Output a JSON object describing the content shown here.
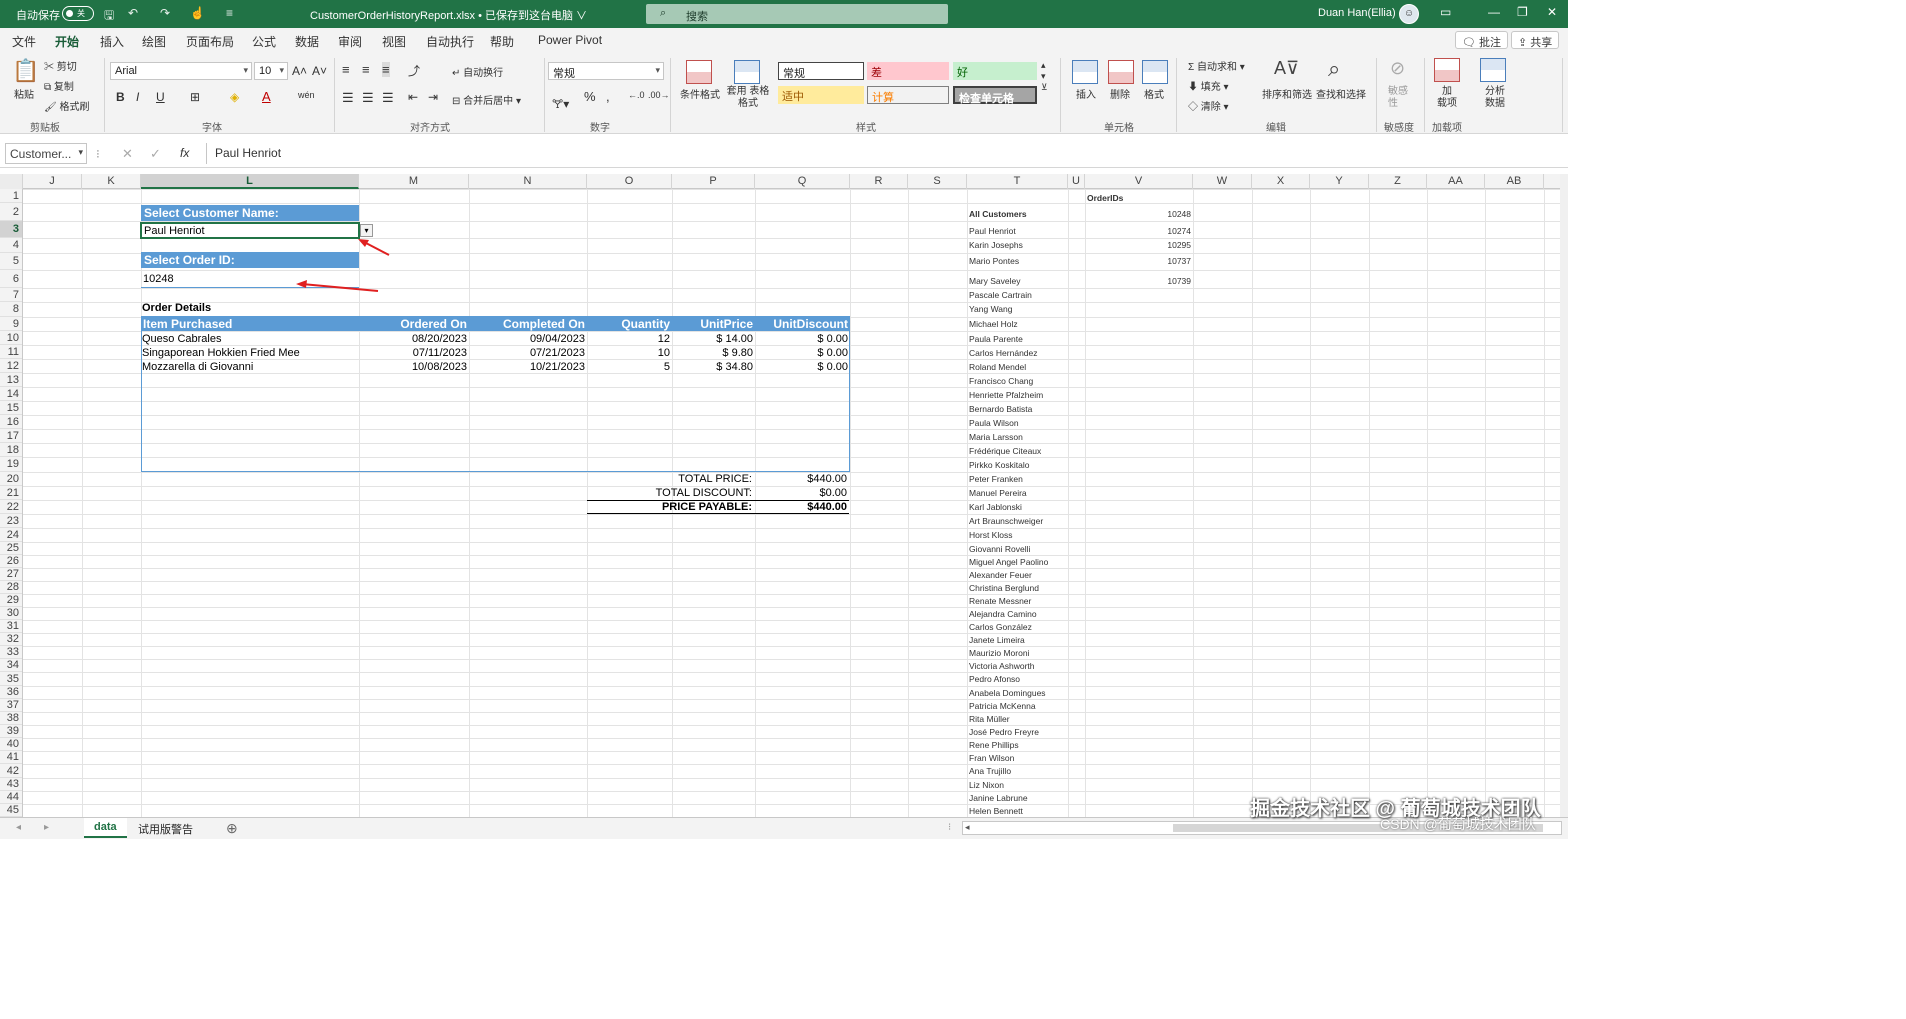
{
  "titlebar": {
    "autosave_label": "自动保存",
    "autosave_state": "关",
    "filename": "CustomerOrderHistoryReport.xlsx • 已保存到这台电脑 ∨",
    "search_placeholder": "搜索",
    "user": "Duan Han(Ellia)"
  },
  "menus": [
    "文件",
    "开始",
    "插入",
    "绘图",
    "页面布局",
    "公式",
    "数据",
    "审阅",
    "视图",
    "自动执行",
    "帮助",
    "Power Pivot"
  ],
  "menu_right": {
    "comment": "批注",
    "share": "共享"
  },
  "ribbon": {
    "clipboard": {
      "paste": "粘贴",
      "cut": "剪切",
      "copy": "复制",
      "format_painter": "格式刷",
      "label": "剪贴板"
    },
    "font": {
      "name": "Arial",
      "size": "10",
      "label": "字体",
      "bold": "B",
      "italic": "I",
      "underline": "U"
    },
    "alignment": {
      "wrap": "自动换行",
      "merge": "合并后居中",
      "label": "对齐方式"
    },
    "number": {
      "format": "常规",
      "label": "数字"
    },
    "styles": {
      "conditional": "条件格式",
      "table": "套用 表格格式",
      "normal": "常规",
      "bad": "差",
      "good": "好",
      "neutral": "适中",
      "calc": "计算",
      "check": "检查单元格",
      "label": "样式"
    },
    "cells": {
      "insert": "插入",
      "delete": "删除",
      "format": "格式",
      "label": "单元格"
    },
    "editing": {
      "autosum": "自动求和",
      "fill": "填充",
      "clear": "清除",
      "sort": "排序和筛选",
      "find": "查找和选择",
      "label": "编辑"
    },
    "sensitivity": {
      "btn": "敏感 性",
      "label": "敏感度"
    },
    "addins": {
      "btn": "加 载项",
      "label": "加载项"
    },
    "analyze": {
      "btn": "分析 数据"
    }
  },
  "formula": {
    "namebox": "Customer...",
    "fx": "fx",
    "value": "Paul Henriot"
  },
  "columns": [
    "J",
    "K",
    "L",
    "M",
    "N",
    "O",
    "P",
    "Q",
    "R",
    "S",
    "T",
    "U",
    "V",
    "W",
    "X",
    "Y",
    "Z",
    "AA",
    "AB"
  ],
  "rows": [
    "1",
    "2",
    "3",
    "4",
    "5",
    "6",
    "7",
    "8",
    "9",
    "10",
    "11",
    "12",
    "13",
    "14",
    "15",
    "16",
    "17",
    "18",
    "19",
    "20",
    "21",
    "22",
    "23",
    "24",
    "25",
    "26",
    "27",
    "28",
    "29",
    "30",
    "31",
    "32",
    "33",
    "34",
    "35",
    "36",
    "37",
    "38",
    "39",
    "40",
    "41",
    "42",
    "43",
    "44",
    "45"
  ],
  "sheet": {
    "select_customer_label": "Select Customer Name:",
    "customer": "Paul Henriot",
    "select_order_label": "Select Order ID:",
    "order_id": "10248",
    "order_details": "Order Details",
    "table_headers": [
      "Item Purchased",
      "Ordered On",
      "Completed On",
      "Quantity",
      "UnitPrice",
      "UnitDiscount"
    ],
    "table_rows": [
      [
        "Queso Cabrales",
        "08/20/2023",
        "09/04/2023",
        "12",
        "$ 14.00",
        "$ 0.00"
      ],
      [
        "Singaporean Hokkien Fried Mee",
        "07/11/2023",
        "07/21/2023",
        "10",
        "$ 9.80",
        "$ 0.00"
      ],
      [
        "Mozzarella di Giovanni",
        "10/08/2023",
        "10/21/2023",
        "5",
        "$ 34.80",
        "$ 0.00"
      ]
    ],
    "totals": [
      {
        "label": "TOTAL PRICE:",
        "value": "$440.00"
      },
      {
        "label": "TOTAL DISCOUNT:",
        "value": "$0.00"
      },
      {
        "label": "PRICE PAYABLE:",
        "value": "$440.00"
      }
    ],
    "orderids_header": "OrderIDs",
    "orderids": [
      "10248",
      "10274",
      "10295",
      "10737",
      "10739"
    ],
    "customers": [
      "All Customers",
      "Paul Henriot",
      "Karin Josephs",
      "Mario Pontes",
      "Mary Saveley",
      "Pascale Cartrain",
      "Yang Wang",
      "Michael Holz",
      "Paula Parente",
      "Carlos Hernández",
      "Roland Mendel",
      "Francisco Chang",
      "Henriette Pfalzheim",
      "Bernardo Batista",
      "Paula Wilson",
      "Maria Larsson",
      "Frédérique Citeaux",
      "Pirkko Koskitalo",
      "Peter Franken",
      "Manuel Pereira",
      "Karl Jablonski",
      "Art Braunschweiger",
      "Horst Kloss",
      "Giovanni Rovelli",
      "Miguel Angel Paolino",
      "Alexander Feuer",
      "Christina Berglund",
      "Renate Messner",
      "Alejandra Camino",
      "Carlos González",
      "Janete Limeira",
      "Maurizio Moroni",
      "Victoria Ashworth",
      "Pedro Afonso",
      "Anabela Domingues",
      "Patricia McKenna",
      "Rita Müller",
      "José Pedro Freyre",
      "Rene Phillips",
      "Fran Wilson",
      "Ana Trujillo",
      "Liz Nixon",
      "Janine Labrune",
      "Helen Bennett"
    ]
  },
  "tabs": [
    "data",
    "试用版警告"
  ],
  "watermark": {
    "line1": "掘金技术社区 @ 葡萄城技术团队",
    "line2": "CSDN @葡萄城技术团队"
  }
}
